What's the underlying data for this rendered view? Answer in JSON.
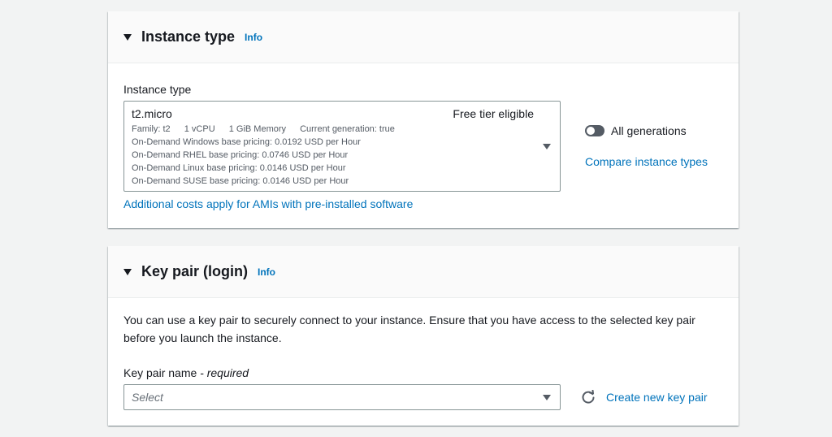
{
  "instance_type_section": {
    "title": "Instance type",
    "info": "Info",
    "field_label": "Instance type",
    "selected": {
      "name": "t2.micro",
      "badge": "Free tier eligible",
      "family": "Family: t2",
      "vcpu": "1 vCPU",
      "memory": "1 GiB Memory",
      "generation": "Current generation: true",
      "pricing": [
        "On-Demand Windows base pricing: 0.0192 USD per Hour",
        "On-Demand RHEL base pricing: 0.0746 USD per Hour",
        "On-Demand Linux base pricing: 0.0146 USD per Hour",
        "On-Demand SUSE base pricing: 0.0146 USD per Hour"
      ]
    },
    "all_generations_label": "All generations",
    "compare_link": "Compare instance types",
    "costs_link": "Additional costs apply for AMIs with pre-installed software"
  },
  "key_pair_section": {
    "title": "Key pair (login)",
    "info": "Info",
    "description": "You can use a key pair to securely connect to your instance. Ensure that you have access to the selected key pair before you launch the instance.",
    "field_label": "Key pair name",
    "required": "- required",
    "placeholder": "Select",
    "create_link": "Create new key pair"
  }
}
